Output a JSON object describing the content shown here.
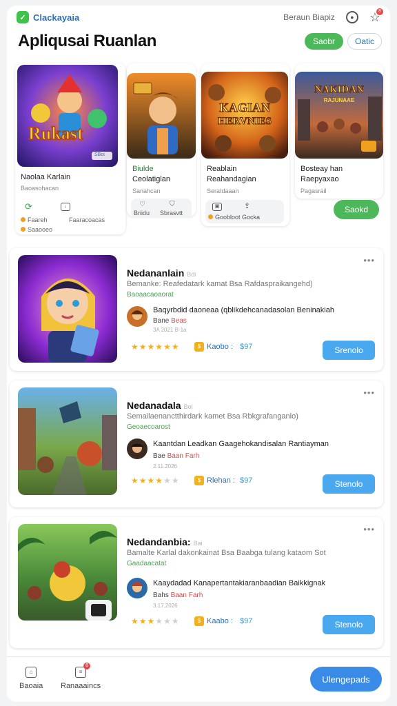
{
  "app": {
    "brand": "Clackayaia",
    "top_link": "Beraun Biapiz",
    "notification_count": "8"
  },
  "header": {
    "title": "Apliqusai Ruanlan",
    "primary_btn": "Saobr",
    "secondary_btn": "Oatic"
  },
  "featured": [
    {
      "name": "Naolaa Karlain",
      "sub": "Baoasohacan",
      "stat1": "Faareh",
      "stat2": "Faaracoacas",
      "stat3": "Saaooeo",
      "badge": "SBoi"
    },
    {
      "name_1": "Biulde",
      "name_2": "Ceolatiglan",
      "sub": "Sariahcan",
      "tag1": "Briidu",
      "tag2": "Sbrasvtt"
    },
    {
      "name_1": "Reablain",
      "name_2": "Reahandagian",
      "sub": "Seratdaaan",
      "tag": "Goobloot Gocka",
      "art_title_1": "KAGIAN",
      "art_title_2": "HERVNIES"
    },
    {
      "name_1": "Bosteay han",
      "name_2": "Raepyaxao",
      "sub": "Pagasrail",
      "art_title_1": "NAKIDAN",
      "art_title_2": "RAJUNAAE"
    }
  ],
  "featured_action": "Saokd",
  "cards": [
    {
      "title": "Nedananlain",
      "badge": "Bdi",
      "desc": "Bemanke: Reafedatark kamat Bsa Rafdaspraikangehd)",
      "green": "Baoaacaoaorat",
      "dev": "Baqyrbdid daoneaa (qblikdehcanadasolan Beninakiah",
      "dev_hl": "aceaa",
      "dev_sub_1": "Bane",
      "dev_sub_2": "Beas",
      "date": "3A 2021 B-1a",
      "stars": "★★★★★★",
      "price_label": "Kaobo :",
      "price_value": "$97",
      "action": "Srenolo",
      "rating": 6
    },
    {
      "title": "Nedanadala",
      "badge": "Bol",
      "desc": "Semailaenanctthirdark kamet Bsa Rbkgrafanganlo)",
      "green": "Geoaecoarost",
      "dev": "Kaantdan Leadkan Gaagehokandisalan Rantiayman",
      "dev_hl": "",
      "dev_sub_1": "Bae",
      "dev_sub_2": "Baan Farh",
      "date": "2.11.2026",
      "stars": "★★★★★★",
      "price_label": "Rlehan :",
      "price_value": "$97",
      "action": "Stenolo",
      "rating": 4
    },
    {
      "title": "Nedandanbia:",
      "badge": "Bai",
      "desc": "Bamalte Karlal dakonkainat Bsa Baabga tulang kataom Sot",
      "green": "Gaadaacatat",
      "dev": "Kaaydadad Kanapertantakiaranbaadian Baikkignak",
      "dev_hl": "apertant",
      "dev_sub_1": "Bahs",
      "dev_sub_2": "Baan Farh",
      "date": "3.17.2026",
      "stars": "★★★★★★",
      "price_label": "Kaabo :",
      "price_value": "$97",
      "action": "Stenolo",
      "rating": 3
    }
  ],
  "bottom_nav": {
    "item1": "Baoaia",
    "item2": "Ranaaaincs",
    "item2_badge": "8",
    "primary": "Ulengepads"
  },
  "colors": {
    "accent_green": "#4cb85a",
    "accent_blue": "#4aa8ee",
    "primary_blue": "#3a8be8",
    "star": "#f2b01e"
  }
}
